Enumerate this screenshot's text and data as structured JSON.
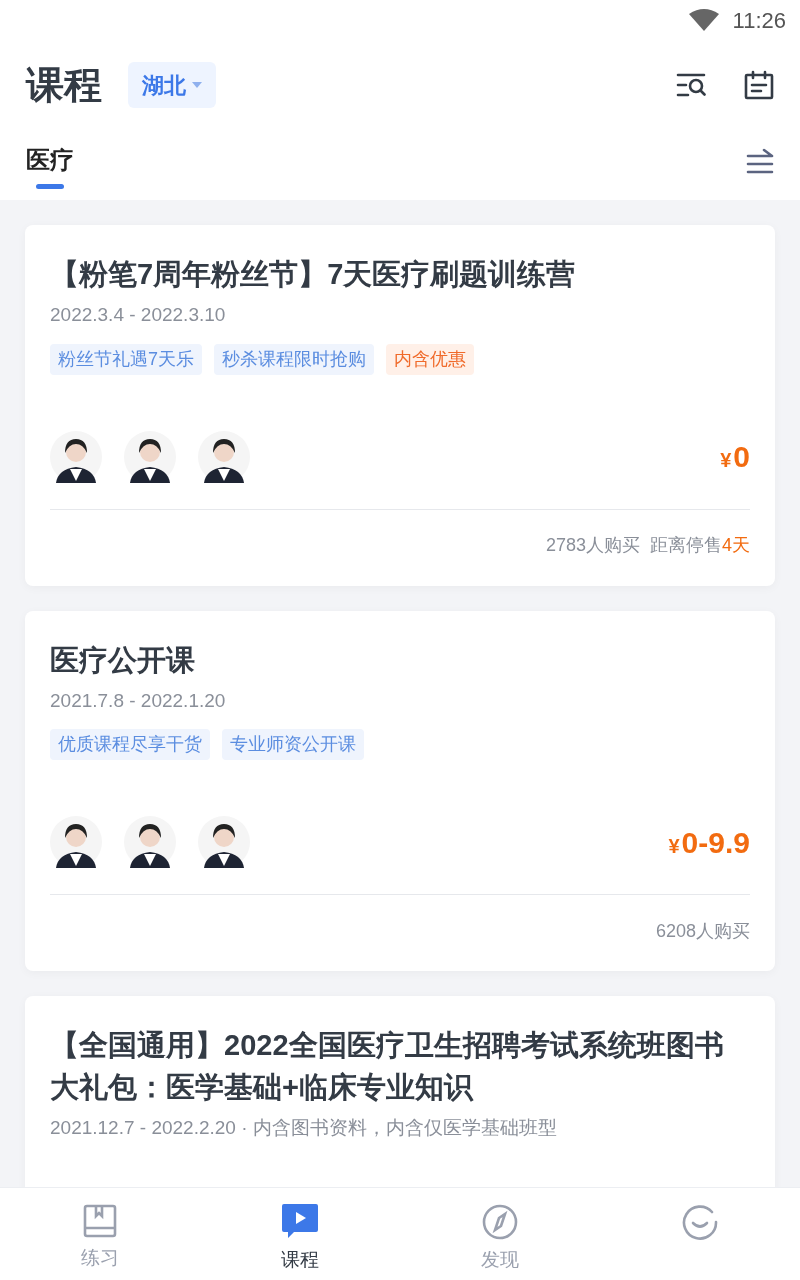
{
  "status_bar": {
    "time": "11:26"
  },
  "header": {
    "title": "课程",
    "region": "湖北"
  },
  "tabs": [
    {
      "label": "医疗",
      "selected": true
    }
  ],
  "courses": [
    {
      "title": "【粉笔7周年粉丝节】7天医疗刷题训练营",
      "dates": "2022.3.4 - 2022.3.10",
      "tags": [
        {
          "label": "粉丝节礼遇7天乐",
          "kind": "info"
        },
        {
          "label": "秒杀课程限时抢购",
          "kind": "info"
        },
        {
          "label": "内含优惠",
          "kind": "promo"
        }
      ],
      "teachers": [
        {
          "kind": "avatar"
        },
        {
          "kind": "avatar"
        },
        {
          "kind": "avatar"
        }
      ],
      "currency": "¥",
      "price": "0",
      "buyers": "2783人购买",
      "countdown_label": "距离停售",
      "countdown": "4天"
    },
    {
      "title": "医疗公开课",
      "dates": "2021.7.8 - 2022.1.20",
      "tags": [
        {
          "label": "优质课程尽享干货",
          "kind": "info"
        },
        {
          "label": "专业师资公开课",
          "kind": "info"
        }
      ],
      "teachers": [
        {
          "kind": "avatar"
        },
        {
          "kind": "avatar"
        },
        {
          "kind": "avatar"
        }
      ],
      "currency": "¥",
      "price": "0-9.9",
      "buyers": "6208人购买"
    },
    {
      "title": "【全国通用】2022全国医疗卫生招聘考试系统班图书大礼包：医学基础+临床专业知识",
      "dates": "2021.12.7 - 2022.2.20 · 内含图书资料，内含仅医学基础班型"
    }
  ],
  "bottom_nav": [
    {
      "label": "练习",
      "kind": "book",
      "selected": false
    },
    {
      "label": "课程",
      "kind": "play",
      "selected": true
    },
    {
      "label": "发现",
      "kind": "compass",
      "selected": false
    },
    {
      "kind": "profile",
      "selected": false
    }
  ]
}
